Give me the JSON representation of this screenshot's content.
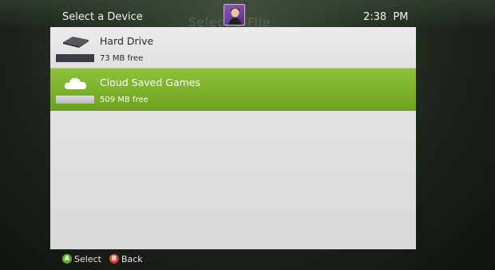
{
  "header": {
    "title": "Select a Device",
    "background_title": "Select a File",
    "clock": "2:38 PM"
  },
  "devices": [
    {
      "name": "Hard Drive",
      "free": "73 MB free",
      "icon": "hard-drive-icon",
      "selected": false,
      "bar_color": "#3a3d41"
    },
    {
      "name": "Cloud Saved Games",
      "free": "509 MB free",
      "icon": "cloud-icon",
      "selected": true,
      "bar_color": "#c8c8c8"
    }
  ],
  "footer": {
    "a_glyph": "A",
    "a_label": "Select",
    "b_glyph": "B",
    "b_label": "Back"
  },
  "colors": {
    "accent": "#7db22c",
    "panel": "#e1e1e1"
  }
}
